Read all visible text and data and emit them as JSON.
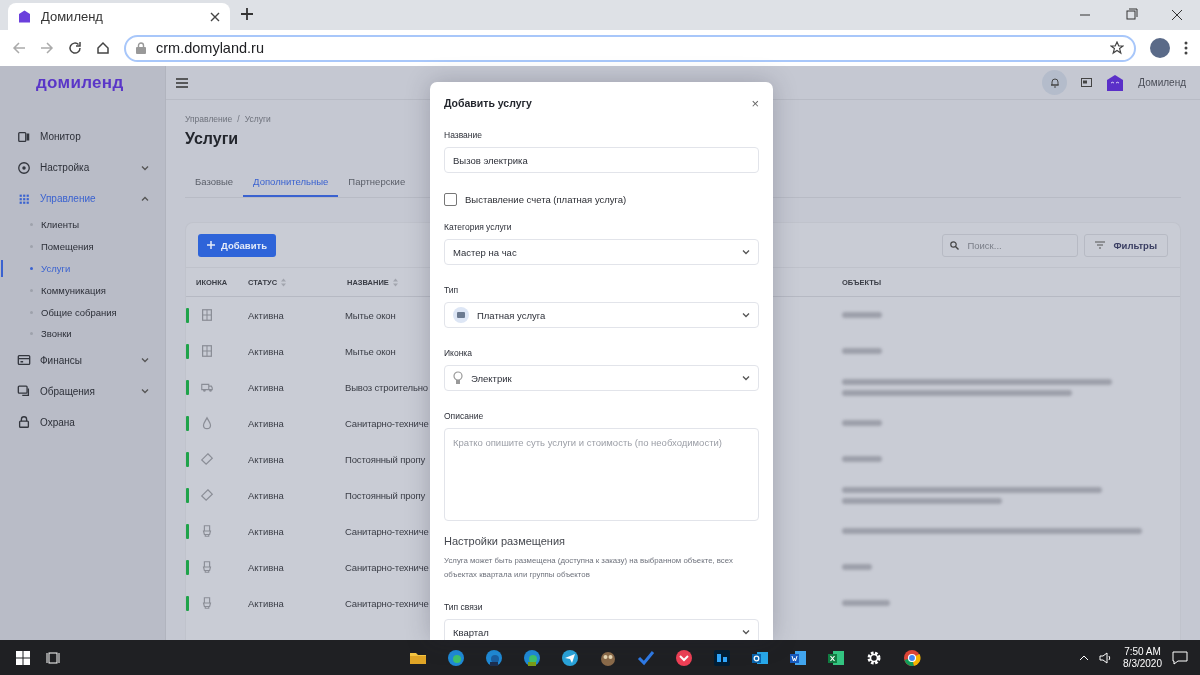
{
  "browser": {
    "tab_title": "Домиленд",
    "url": "crm.domyland.ru"
  },
  "logo": "домиленд",
  "header": {
    "user": "Домиленд"
  },
  "sidebar": {
    "items": [
      {
        "label": "Монитор",
        "kind": "link",
        "selected": false
      },
      {
        "label": "Настройка",
        "kind": "group",
        "selected": false,
        "expanded": false
      },
      {
        "label": "Управление",
        "kind": "group",
        "selected": true,
        "expanded": true,
        "children": [
          {
            "label": "Клиенты",
            "selected": false
          },
          {
            "label": "Помещения",
            "selected": false
          },
          {
            "label": "Услуги",
            "selected": true
          },
          {
            "label": "Коммуникация",
            "selected": false
          },
          {
            "label": "Общие собрания",
            "selected": false
          },
          {
            "label": "Звонки",
            "selected": false
          }
        ]
      },
      {
        "label": "Финансы",
        "kind": "group",
        "selected": false,
        "expanded": false
      },
      {
        "label": "Обращения",
        "kind": "group",
        "selected": false,
        "expanded": false
      },
      {
        "label": "Охрана",
        "kind": "link",
        "selected": false
      }
    ]
  },
  "breadcrumb": {
    "items": [
      "Управление",
      "Услуги"
    ],
    "separator": "/"
  },
  "page_title": "Услуги",
  "tabs": [
    {
      "label": "Базовые",
      "selected": false
    },
    {
      "label": "Дополнительные",
      "selected": true
    },
    {
      "label": "Партнерские",
      "selected": false
    }
  ],
  "toolbar": {
    "add_button": "Добавить",
    "search": {
      "placeholder": "Поиск..."
    },
    "filter_button": "Фильтры"
  },
  "table": {
    "columns": [
      {
        "label": "ИКОНКА",
        "sortable": false
      },
      {
        "label": "СТАТУС",
        "sortable": true
      },
      {
        "label": "НАЗВАНИЕ",
        "sortable": true
      },
      {
        "label": "ОБЪЕКТЫ",
        "sortable": false
      }
    ],
    "rows": [
      {
        "kind": "window",
        "status": "Активна",
        "name": "Мытье окон"
      },
      {
        "kind": "window",
        "status": "Активна",
        "name": "Мытье окон"
      },
      {
        "kind": "truck",
        "status": "Активна",
        "name": "Вывоз строительно"
      },
      {
        "kind": "drop",
        "status": "Активна",
        "name": "Санитарно-техниче"
      },
      {
        "kind": "ticket",
        "status": "Активна",
        "name": "Постоянный пропу"
      },
      {
        "kind": "ticket",
        "status": "Активна",
        "name": "Постоянный пропу"
      },
      {
        "kind": "toilet",
        "status": "Активна",
        "name": "Санитарно-техниче"
      },
      {
        "kind": "toilet",
        "status": "Активна",
        "name": "Санитарно-техниче"
      },
      {
        "kind": "toilet",
        "status": "Активна",
        "name": "Санитарно-техниче"
      }
    ]
  },
  "modal": {
    "title": "Добавить услугу",
    "close": "×",
    "fields": [
      {
        "kind": "text",
        "label": "Название",
        "value": "Вызов электрика"
      },
      {
        "kind": "checkbox",
        "label": "Выставление счета (платная услуга)",
        "checked": false
      },
      {
        "kind": "select",
        "label": "Категория услуги",
        "value": "Мастер на час"
      },
      {
        "kind": "select",
        "label": "Тип",
        "value": "Платная услуга"
      },
      {
        "kind": "select",
        "label": "Иконка",
        "value": "Электрик"
      },
      {
        "kind": "textarea",
        "label": "Описание",
        "placeholder": "Кратко опишите суть услуги и стоимость (по необходимости)"
      },
      {
        "kind": "section",
        "title": "Настройки размещения",
        "text": "Услуга может быть размещена (доступна к заказу) на выбранном объекте, всех объектах квартала или группы объектов"
      },
      {
        "kind": "select",
        "label": "Тип связи",
        "value": "Квартал"
      }
    ]
  },
  "taskbar": {
    "apps": [
      {
        "kind": "folder"
      },
      {
        "kind": "edge"
      },
      {
        "kind": "edge-beta"
      },
      {
        "kind": "edge-dev"
      },
      {
        "kind": "plane"
      },
      {
        "kind": "owl"
      },
      {
        "kind": "check"
      },
      {
        "kind": "pocket"
      },
      {
        "kind": "ps"
      },
      {
        "kind": "outlook"
      },
      {
        "kind": "word"
      },
      {
        "kind": "excel"
      },
      {
        "kind": "gear"
      },
      {
        "kind": "chrome"
      }
    ],
    "time": "7:50 AM",
    "date": "8/3/2020"
  }
}
